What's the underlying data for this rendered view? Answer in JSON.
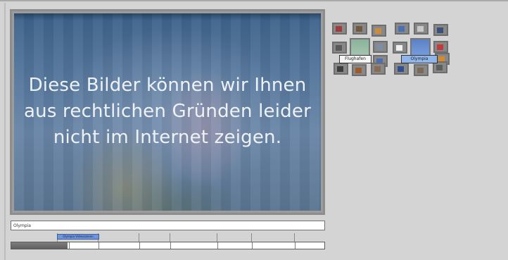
{
  "video": {
    "message_lines": [
      "Diese Bilder können wir Ihnen",
      "aus rechtlichen Gründen leider",
      "nicht im Internet zeigen."
    ]
  },
  "clusters": [
    {
      "label": "Flughafen",
      "thumb_colors": [
        "#a33a3a",
        "#6f5a3c",
        "#c98c45",
        "#5a5a5a",
        "#7d8fa6",
        "#4a6fb4",
        "#3d3d3d",
        "#9a5c2e",
        "#8a6a50"
      ]
    },
    {
      "label": "Olympia",
      "thumb_colors": [
        "#4a6fb4",
        "#c9c9c9",
        "#3c4f7a",
        "#f0f0f0",
        "#c43a3a",
        "#d68a30",
        "#2f4f8f",
        "#7b6a55",
        "#5d5d5d"
      ]
    }
  ],
  "title_input": {
    "value": "Olympia"
  },
  "timeline": {
    "marker_label": "Olympia Videoszenen",
    "progress": 0.18
  }
}
